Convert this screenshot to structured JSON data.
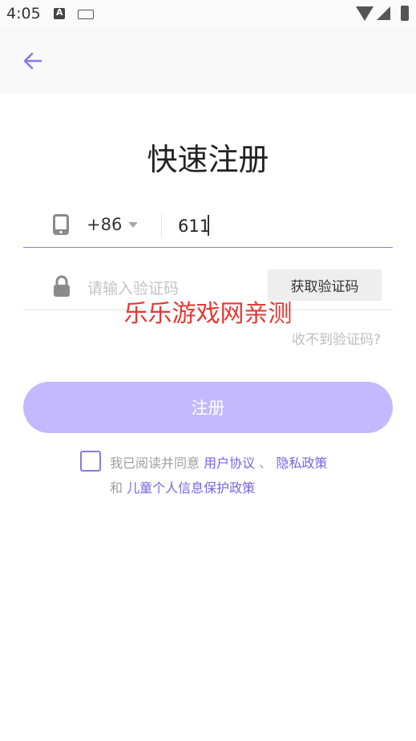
{
  "status_bar": {
    "time": "4:05",
    "a_icon": "A",
    "icons": [
      "a-notification-icon",
      "keyboard-icon",
      "wifi-icon",
      "signal-icon",
      "battery-icon"
    ]
  },
  "app_bar": {
    "back_icon": "arrow-left-icon",
    "accent": "#8b77e8"
  },
  "page": {
    "title": "快速注册"
  },
  "phone": {
    "country_code": "+86",
    "value": "611",
    "icon": "phone-icon"
  },
  "code": {
    "placeholder": "请输入验证码",
    "button_label": "获取验证码",
    "icon": "lock-icon"
  },
  "watermark": "乐乐游戏网亲测",
  "not_received": "收不到验证码?",
  "register": {
    "label": "注册",
    "color": "#c4b9ff"
  },
  "agreement": {
    "prefix": "我已阅读并同意",
    "user_agreement": "用户协议",
    "separator": "、",
    "privacy_policy": "隐私政策",
    "and": "和",
    "child_policy": "儿童个人信息保护政策",
    "link_color": "#7a62e8"
  }
}
